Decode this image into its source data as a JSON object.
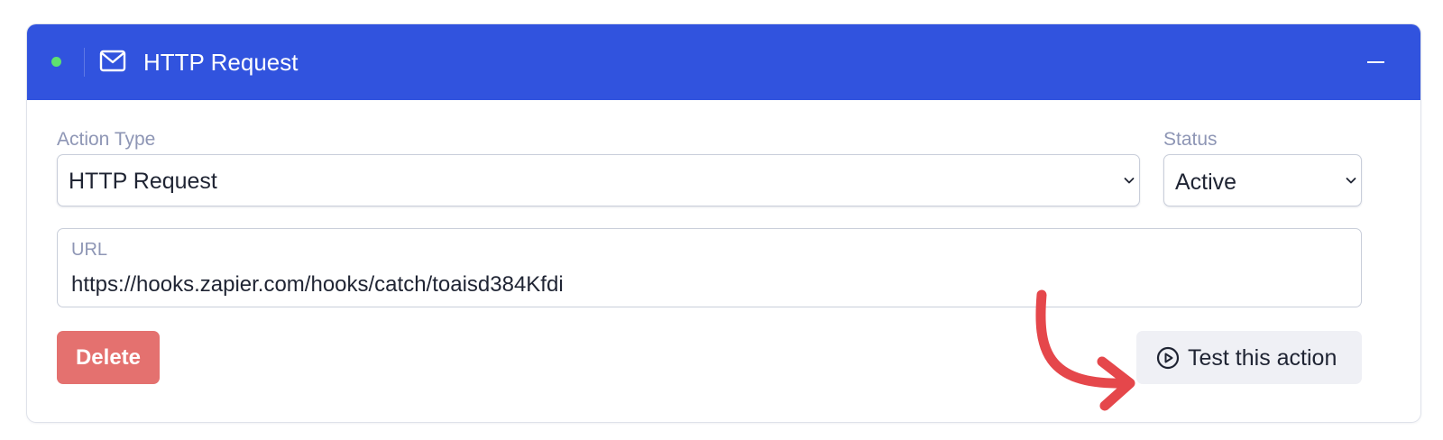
{
  "header": {
    "title": "HTTP Request",
    "status_dot_color": "#5ee16f",
    "background_color": "#3153de",
    "icon": "mail-icon",
    "collapse_icon": "minus-icon"
  },
  "fields": {
    "action_type": {
      "label": "Action Type",
      "value": "HTTP Request"
    },
    "status": {
      "label": "Status",
      "value": "Active"
    },
    "url": {
      "label": "URL",
      "value": "https://hooks.zapier.com/hooks/catch/toaisd384Kfdi"
    }
  },
  "actions": {
    "delete_label": "Delete",
    "delete_color": "#e4716f",
    "test_label": "Test this action",
    "test_icon": "play-circle-icon"
  },
  "annotation": {
    "arrow_color": "#e5474b",
    "arrow_icon": "curved-arrow-icon"
  }
}
